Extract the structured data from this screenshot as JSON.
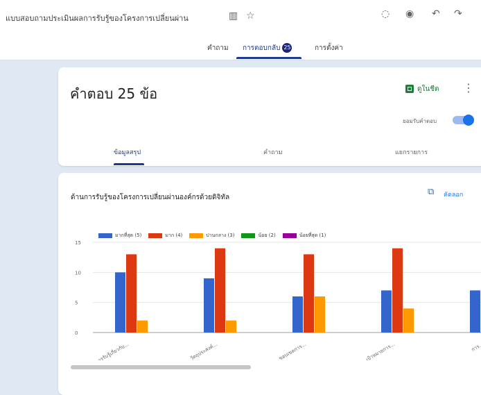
{
  "header": {
    "doc_title": "แบบสอบถามประเมินผลการรับรู้ของโครงการเปลี่ยนผ่าน",
    "icons": [
      "move-to-folder-icon",
      "star-icon",
      "palette-icon",
      "preview-icon",
      "undo-icon",
      "redo-icon"
    ],
    "tabs": [
      {
        "label": "คำถาม"
      },
      {
        "label": "การตอบกลับ",
        "badge": "25"
      },
      {
        "label": "การตั้งค่า"
      }
    ]
  },
  "summary": {
    "title": "คำตอบ 25 ข้อ",
    "sheets_label": "ดูในชีต",
    "accepting_label": "ยอมรับคำตอบ",
    "accepting": true,
    "sub_tabs": [
      "ข้อมูลสรุป",
      "คำถาม",
      "แยกรายการ"
    ]
  },
  "question": {
    "title": "ด้านการรับรู้ของโครงการเปลี่ยนผ่านองค์กรด้วยดิจิทัล",
    "copy_label": "คัดลอก"
  },
  "chart_data": {
    "type": "bar",
    "title": "",
    "xlabel": "",
    "ylabel": "",
    "ylim": [
      0,
      15
    ],
    "yticks": [
      0,
      5,
      10,
      15
    ],
    "grid": true,
    "legend_position": "top",
    "categories": [
      "การรับรู้เกี่ยวกับ...",
      "วัตถุประสงค์...",
      "ขอบเขตการ...",
      "เป้าหมายการ...",
      "การ..."
    ],
    "series": [
      {
        "name": "มากที่สุด (5)",
        "color": "#3366cc",
        "values": [
          10,
          9,
          6,
          7,
          7
        ]
      },
      {
        "name": "มาก (4)",
        "color": "#dc3912",
        "values": [
          13,
          14,
          13,
          14,
          0
        ]
      },
      {
        "name": "ปานกลาง (3)",
        "color": "#ff9900",
        "values": [
          2,
          2,
          6,
          4,
          0
        ]
      },
      {
        "name": "น้อย (2)",
        "color": "#109618",
        "values": [
          0,
          0,
          0,
          0,
          0
        ]
      },
      {
        "name": "น้อยที่สุด (1)",
        "color": "#990099",
        "values": [
          0,
          0,
          0,
          0,
          0
        ]
      }
    ]
  }
}
